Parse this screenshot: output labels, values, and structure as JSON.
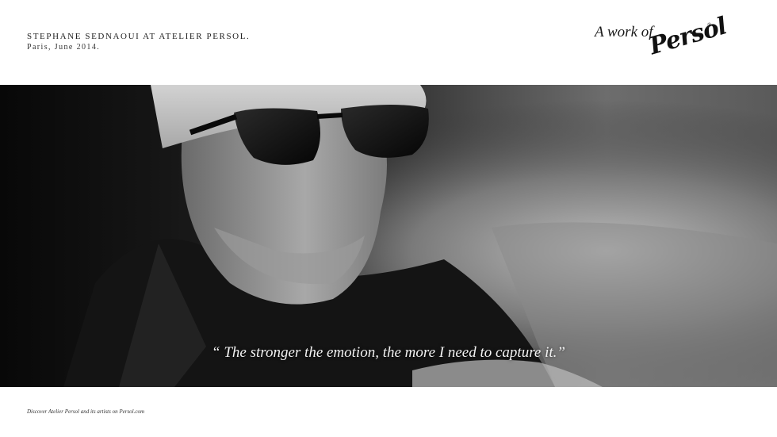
{
  "header": {
    "credit_name": "STEPHANE SEDNAOUI AT ATELIER PERSOL.",
    "credit_date": "Paris, June 2014.",
    "brand_prefix": "A work of",
    "brand_logo": "Persol",
    "brand_registered": "®"
  },
  "photo": {
    "quote": "“ The stronger the emotion, the more I need to capture it.”",
    "palette": {
      "dark": "#0a0a0a",
      "mid": "#4c4c4c",
      "light": "#d8d8d8"
    }
  },
  "footer": {
    "text": "Discover Atelier Persol and its artists on Persol.com"
  }
}
